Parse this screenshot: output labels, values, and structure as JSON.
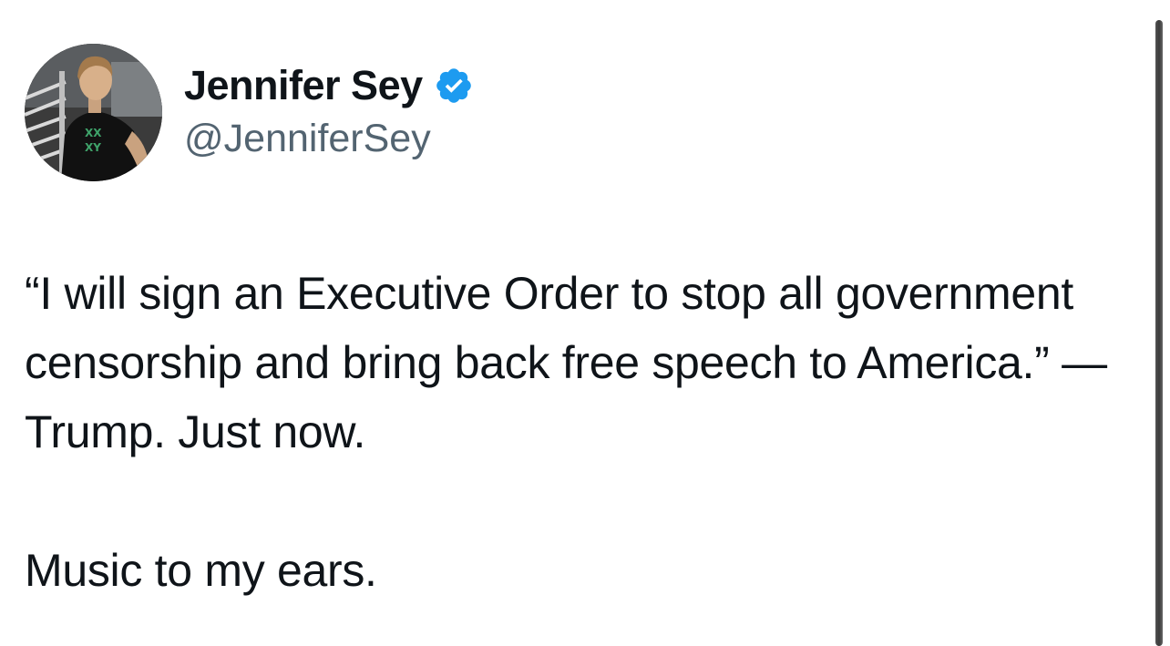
{
  "author": {
    "display_name": "Jennifer Sey",
    "handle": "@JenniferSey",
    "verified": true,
    "verified_color": "#1d9bf0"
  },
  "tweet": {
    "paragraphs": [
      "“I will sign an Executive Order to stop all government censorship and bring back free speech to America.” — Trump. Just now.",
      "Music to my ears."
    ]
  },
  "icons": {
    "verified": "verified-badge-icon"
  },
  "colors": {
    "text_primary": "#0f1419",
    "text_secondary": "#536471",
    "background": "#ffffff"
  }
}
